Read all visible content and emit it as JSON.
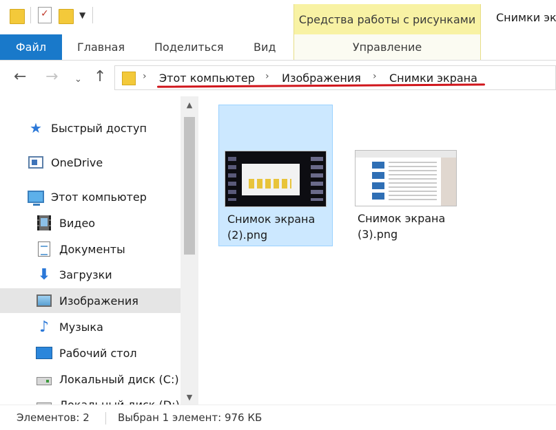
{
  "ribbon": {
    "tools_tab": "Средства работы с рисунками",
    "window_title": "Снимки экра",
    "tabs": {
      "file": "Файл",
      "home": "Главная",
      "share": "Поделиться",
      "view": "Вид",
      "manage": "Управление"
    }
  },
  "address": {
    "crumbs": [
      "Этот компьютер",
      "Изображения",
      "Снимки экрана"
    ]
  },
  "sidebar": {
    "items": [
      {
        "label": "Быстрый доступ",
        "icon": "star-icon"
      },
      {
        "label": "OneDrive",
        "icon": "onedrive-icon"
      },
      {
        "label": "Этот компьютер",
        "icon": "computer-icon"
      },
      {
        "label": "Видео",
        "icon": "video-icon"
      },
      {
        "label": "Документы",
        "icon": "documents-icon"
      },
      {
        "label": "Загрузки",
        "icon": "download-arrow-icon"
      },
      {
        "label": "Изображения",
        "icon": "pictures-icon",
        "selected": true
      },
      {
        "label": "Музыка",
        "icon": "music-note-icon"
      },
      {
        "label": "Рабочий стол",
        "icon": "desktop-icon"
      },
      {
        "label": "Локальный диск (C:)",
        "icon": "drive-icon"
      },
      {
        "label": "Локальный диск (D:)",
        "icon": "drive-icon"
      }
    ]
  },
  "files": [
    {
      "name": "Снимок экрана (2).png",
      "selected": true
    },
    {
      "name": "Снимок экрана (3).png",
      "selected": false
    }
  ],
  "status": {
    "count": "Элементов: 2",
    "selected": "Выбран 1 элемент: 976 КБ"
  },
  "colors": {
    "file_tab": "#1979ca",
    "tools_tab": "#f8f2a4",
    "selection": "#cce8ff",
    "annotation_underline": "#d0141a"
  }
}
